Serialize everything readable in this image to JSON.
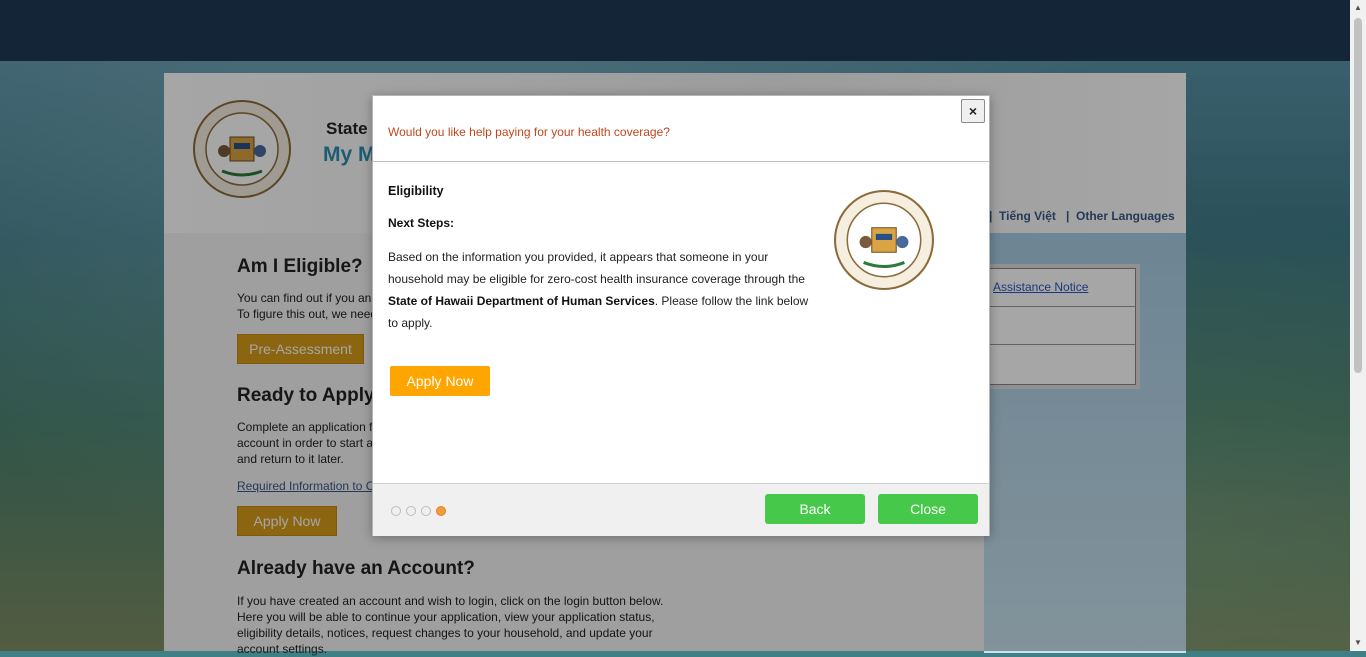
{
  "background_page": {
    "header": {
      "state_text": "State",
      "sub_text": "My M"
    },
    "languages": {
      "item1": "Tiếng Việt",
      "separator": "|",
      "item2": "Other Languages"
    },
    "right_panel": {
      "link": "Assistance Notice"
    },
    "am_i_eligible": {
      "heading": "Am I Eligible?",
      "line1": "You can find out if you an",
      "line2": "To figure this out, we need",
      "button": "Pre-Assessment"
    },
    "ready_to_apply": {
      "heading": "Ready to Apply",
      "line1": "Complete an application f",
      "line2": "account in order to start a",
      "line3": "and return to it later.",
      "link": "Required Information to C",
      "button": "Apply Now"
    },
    "already_have_account": {
      "heading": "Already have an Account?",
      "line1": "If you have created an account and wish to login, click on the login button below.",
      "line2": "Here you will be able to continue your application, view your application status,",
      "line3": "eligibility details, notices, request changes to your household, and update your",
      "line4": "account settings."
    }
  },
  "modal": {
    "close_symbol": "×",
    "title": "Would you like help paying for your health coverage?",
    "section_heading": "Eligibility",
    "next_steps": "Next Steps:",
    "body_part1": "Based on the information you provided, it appears that someone in your household may be eligible for zero-cost health insurance coverage through the ",
    "body_bold": "State of Hawaii Department of Human Services",
    "body_part2": ". Please follow the link below to apply.",
    "apply_button": "Apply Now",
    "steps_total": 4,
    "steps_active_index": 3,
    "back_button": "Back",
    "close_button": "Close"
  },
  "colors": {
    "topbar": "#1f3a55",
    "modal_title": "#c0471c",
    "apply_orange": "#ffa500",
    "green_button": "#46c84a",
    "active_dot": "#f39a3c"
  }
}
